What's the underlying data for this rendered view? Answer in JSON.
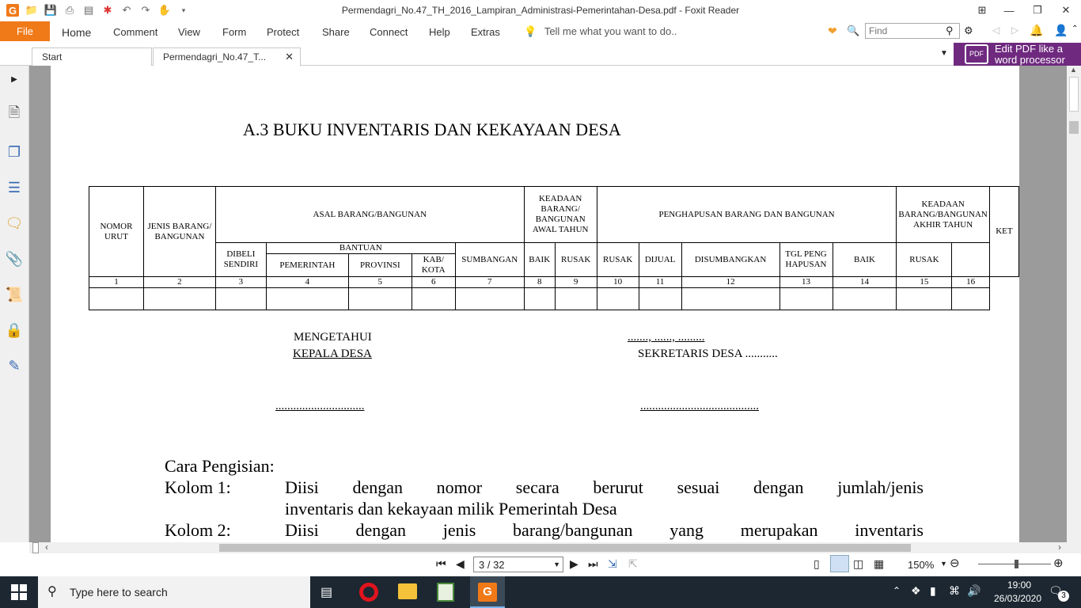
{
  "window": {
    "title": "Permendagri_No.47_TH_2016_Lampiran_Administrasi-Pemerintahan-Desa.pdf - Foxit Reader"
  },
  "ribbon": {
    "file": "File",
    "tabs": [
      "Home",
      "Comment",
      "View",
      "Form",
      "Protect",
      "Share",
      "Connect",
      "Help",
      "Extras"
    ],
    "tell_me": "Tell me what you want to do..",
    "find_placeholder": "Find"
  },
  "doc_tabs": {
    "start": "Start",
    "active": "Permendagri_No.47_T..."
  },
  "ad": {
    "line1": "Edit PDF like a",
    "line2": "word processor"
  },
  "document": {
    "heading": "A.3 BUKU INVENTARIS DAN KEKAYAAN DESA",
    "table": {
      "h_nomor": "NOMOR URUT",
      "h_jenis": "JENIS BARANG/ BANGUNAN",
      "h_asal": "ASAL BARANG/BANGUNAN",
      "h_keadaan_awal": "KEADAAN BARANG/ BANGUNAN AWAL TAHUN",
      "h_penghapusan": "PENGHAPUSAN BARANG DAN BANGUNAN",
      "h_keadaan_akhir": "KEADAAN BARANG/BANGUNAN AKHIR TAHUN",
      "h_ket": "KET",
      "h_dibeli": "DIBELI SENDIRI",
      "h_bantuan": "BANTUAN",
      "h_pemerintah": "PEMERINTAH",
      "h_provinsi": "PROVINSI",
      "h_kabkota": "KAB/ KOTA",
      "h_sumbangan": "SUMBANGAN",
      "h_baik": "BAIK",
      "h_rusak": "RUSAK",
      "h_rusak2": "RUSAK",
      "h_dijual": "DIJUAL",
      "h_disumbangkan": "DISUMBANGKAN",
      "h_tgl": "TGL PENG HAPUSAN",
      "h_baik2": "BAIK",
      "h_rusak3": "RUSAK",
      "numbers": [
        "1",
        "2",
        "3",
        "4",
        "5",
        "6",
        "7",
        "8",
        "9",
        "10",
        "11",
        "12",
        "13",
        "14",
        "15",
        "16"
      ]
    },
    "sig": {
      "mengetahui": "MENGETAHUI",
      "kepala": "KEPALA DESA",
      "date": "......., ......, .........",
      "sekretaris": "SEKRETARIS DESA ...........",
      "dots_left": "..............................",
      "dots_right": "........................................"
    },
    "cara": "Cara Pengisian:",
    "k1_label": "Kolom 1:",
    "k1_line1": "Diisi dengan nomor secara berurut sesuai dengan jumlah/jenis",
    "k1_line2": "inventaris dan kekayaan milik Pemerintah Desa",
    "k2_label": "Kolom 2:",
    "k2_line1": "Diisi dengan jenis barang/bangunan yang merupakan inventaris"
  },
  "nav": {
    "page": "3 / 32",
    "zoom": "150%"
  },
  "taskbar": {
    "search": "Type here to search",
    "time": "19:00",
    "date": "26/03/2020",
    "notif": "3"
  }
}
